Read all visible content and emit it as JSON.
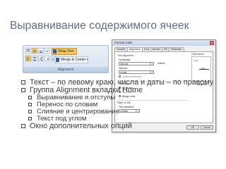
{
  "title": "Выравнивание содержимого ячеек",
  "ribbon": {
    "wrap_text": "Wrap Text",
    "merge_center": "Merge & Center",
    "merge_arrow": "▾",
    "group_label": "Alignment"
  },
  "dialog": {
    "title": "Format Cells",
    "close": "x",
    "tabs": [
      "Number",
      "Alignment",
      "Font",
      "Border",
      "Fill",
      "Protection"
    ],
    "active_tab": "Alignment",
    "text_alignment_label": "Text alignment",
    "horizontal_label": "Horizontal:",
    "horizontal_value": "General",
    "indent_label": "Indent:",
    "vertical_label": "Vertical:",
    "vertical_value": "Center",
    "justify_distributed": "Justify distributed",
    "text_control_label": "Text control",
    "wrap_text": "Wrap text",
    "shrink_to_fit": "Shrink to fit",
    "merge_cells": "Merge cells",
    "rtl_label": "Right-to-left",
    "text_direction_label": "Text direction:",
    "text_direction_value": "Context",
    "orientation_label": "Orientation",
    "orientation_vertical_text": "Text",
    "orientation_needle_label": "Text",
    "degrees_label": "Degrees",
    "ok": "OK",
    "cancel": "Cancel"
  },
  "bullets": [
    {
      "text": "Текст – по левому краю, числа и даты – по правому",
      "level": 1
    },
    {
      "text": "Группа Alignment вкладки Home",
      "level": 1
    },
    {
      "text": "Выравнивание и отступы",
      "level": 2
    },
    {
      "text": "Перенос по словам",
      "level": 2
    },
    {
      "text": "Слияние и центрирование",
      "level": 2
    },
    {
      "text": "Текст под углом",
      "level": 2
    },
    {
      "text": "Окно дополнительных опций",
      "level": 1
    }
  ]
}
